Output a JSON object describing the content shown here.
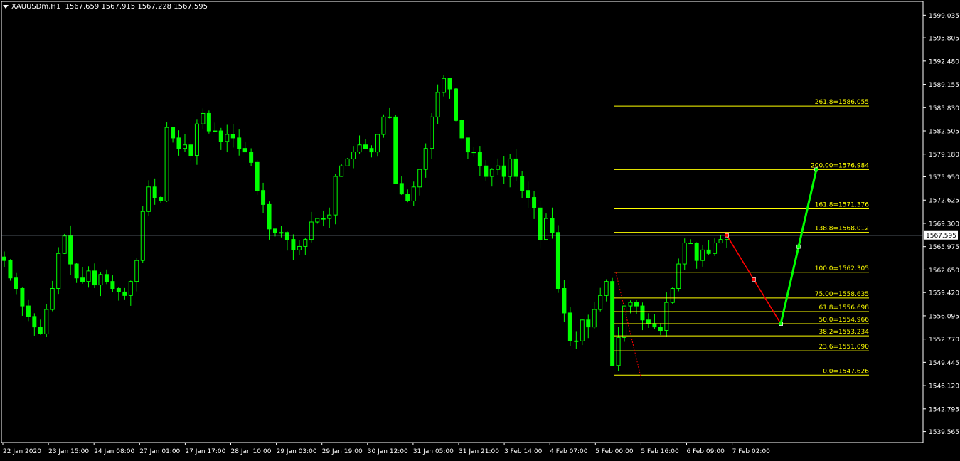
{
  "window": {
    "symbol_timeframe": "XAUUSDm,H1",
    "ohlc": "1567.659 1567.915 1567.228 1567.595"
  },
  "chart_data": {
    "type": "candlestick",
    "title": "XAUUSDm,H1",
    "ylim": [
      1538.0,
      1601.0
    ],
    "current_price": "1567.595",
    "price_ticks": [
      "1599.035",
      "1595.805",
      "1592.480",
      "1589.155",
      "1585.830",
      "1582.505",
      "1579.180",
      "1575.950",
      "1572.625",
      "1569.300",
      "1565.975",
      "1562.650",
      "1559.420",
      "1556.095",
      "1552.770",
      "1549.445",
      "1546.120",
      "1542.795",
      "1539.565"
    ],
    "time_labels": [
      "22 Jan 2020",
      "23 Jan 15:00",
      "24 Jan 08:00",
      "27 Jan 01:00",
      "27 Jan 17:00",
      "28 Jan 10:00",
      "29 Jan 03:00",
      "29 Jan 19:00",
      "30 Jan 12:00",
      "31 Jan 05:00",
      "31 Jan 21:00",
      "3 Feb 14:00",
      "4 Feb 07:00",
      "5 Feb 00:00",
      "5 Feb 16:00",
      "6 Feb 09:00",
      "7 Feb 02:00"
    ],
    "fib_levels": [
      {
        "label": "261.8=1586.055",
        "price": 1586.055
      },
      {
        "label": "200.00=1576.984",
        "price": 1576.984
      },
      {
        "label": "161.8=1571.376",
        "price": 1571.376
      },
      {
        "label": "138.8=1568.012",
        "price": 1568.012
      },
      {
        "label": "100.0=1562.305",
        "price": 1562.305
      },
      {
        "label": "75.00=1558.635",
        "price": 1558.635
      },
      {
        "label": "61.8=1556.698",
        "price": 1556.698
      },
      {
        "label": "50.0=1554.966",
        "price": 1554.966
      },
      {
        "label": "38.2=1553.234",
        "price": 1553.234
      },
      {
        "label": "23.6=1551.090",
        "price": 1551.09
      },
      {
        "label": "0.0=1547.626",
        "price": 1547.626
      }
    ],
    "close_path": [
      1564.0,
      1561.5,
      1560.0,
      1557.5,
      1556.0,
      1554.5,
      1553.5,
      1557.0,
      1560.0,
      1565.0,
      1567.5,
      1563.5,
      1561.5,
      1561.0,
      1562.5,
      1560.5,
      1562.0,
      1561.0,
      1560.0,
      1559.5,
      1559.0,
      1561.0,
      1564.0,
      1571.0,
      1574.5,
      1573.0,
      1572.5,
      1583.0,
      1581.5,
      1580.0,
      1580.5,
      1579.0,
      1583.5,
      1585.0,
      1582.5,
      1582.5,
      1581.0,
      1582.0,
      1581.5,
      1580.0,
      1579.5,
      1578.0,
      1574.0,
      1572.0,
      1568.5,
      1568.0,
      1568.0,
      1567.0,
      1565.5,
      1566.0,
      1567.0,
      1569.5,
      1570.0,
      1570.0,
      1570.5,
      1576.0,
      1577.5,
      1578.5,
      1579.5,
      1580.5,
      1580.0,
      1579.5,
      1582.0,
      1584.5,
      1584.5,
      1575.0,
      1573.5,
      1572.5,
      1574.5,
      1577.0,
      1580.0,
      1584.5,
      1588.0,
      1590.0,
      1588.5,
      1584.0,
      1581.5,
      1579.5,
      1579.5,
      1577.5,
      1576.0,
      1577.0,
      1577.5,
      1576.0,
      1578.5,
      1576.0,
      1574.0,
      1573.0,
      1571.5,
      1567.0,
      1570.0,
      1568.0,
      1560.0,
      1556.5,
      1552.5,
      1552.5,
      1555.5,
      1554.5,
      1557.0,
      1559.0,
      1561.0,
      1549.0,
      1553.0,
      1557.5,
      1558.0,
      1557.5,
      1555.5,
      1555.0,
      1554.5,
      1554.0,
      1558.0,
      1560.0,
      1563.5,
      1566.5,
      1566.5,
      1564.0,
      1565.5,
      1565.0,
      1566.5,
      1567.0,
      1567.6
    ],
    "projection": [
      {
        "from": 1567.6,
        "to": 1554.966,
        "color": "#ff0000"
      },
      {
        "from": 1554.966,
        "to": 1576.984,
        "color": "#00ff00"
      }
    ],
    "colors": {
      "candle": "#00ff00",
      "fib": "#ffff00",
      "price_line": "#9aa7b8",
      "axis_text": "#ffffff",
      "down_projection": "#ff0000",
      "up_projection": "#00ff00"
    }
  }
}
